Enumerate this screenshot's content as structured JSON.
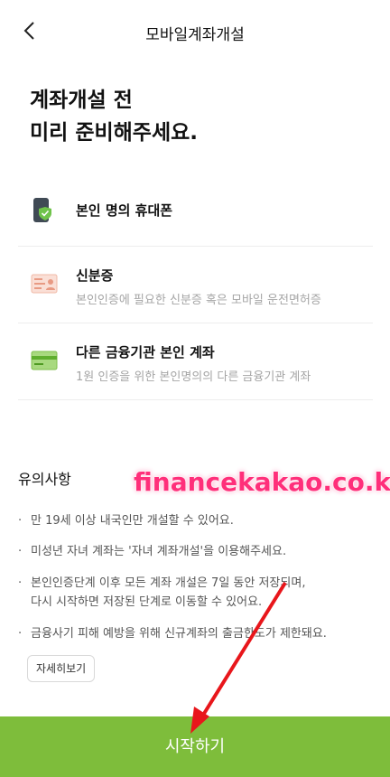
{
  "header": {
    "title": "모바일계좌개설",
    "back_icon": "chevron-left-icon"
  },
  "headline": {
    "line1": "계좌개설 전",
    "line2": "미리 준비해주세요."
  },
  "items": [
    {
      "name": "본인 명의 휴대폰",
      "desc": "",
      "icon": "phone-shield-icon"
    },
    {
      "name": "신분증",
      "desc": "본인인증에 필요한 신분증 혹은 모바일 운전면허증",
      "icon": "id-card-icon"
    },
    {
      "name": "다른 금융기관 본인 계좌",
      "desc": "1원 인증을 위한 본인명의의 다른 금융기관 계좌",
      "icon": "bank-card-icon"
    }
  ],
  "notice": {
    "title": "유의사항",
    "bullets": [
      "만 19세 이상 내국인만 개설할 수 있어요.",
      "미성년 자녀 계좌는 '자녀 계좌개설'을 이용해주세요.",
      "본인인증단계 이후 모든 계좌 개설은 7일 동안 저장되며,",
      "다시 시작하면 저장된 단계로 이동할 수 있어요.",
      "금융사기 피해 예방을 위해 신규계좌의 출금한도가 제한돼요."
    ],
    "detail_label": "자세히보기"
  },
  "cta": {
    "label": "시작하기"
  },
  "watermark": "financekakao.co.kr",
  "colors": {
    "accent": "#7ebd3b",
    "watermark": "#ff2f7a",
    "arrow": "#e8161b"
  }
}
